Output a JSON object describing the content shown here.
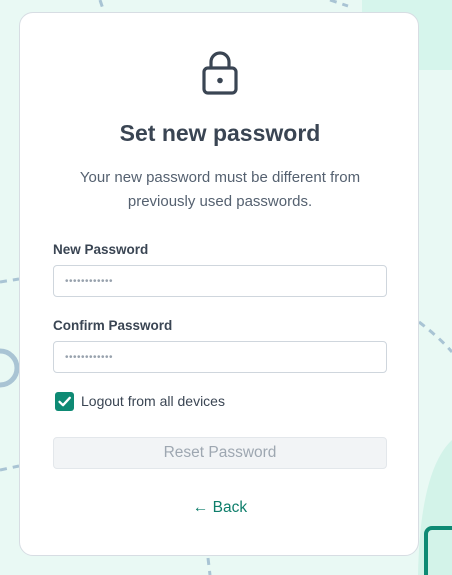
{
  "card": {
    "title": "Set new password",
    "subtitle": "Your new password must be different from previously used passwords."
  },
  "form": {
    "new_password": {
      "label": "New Password",
      "value": "••••••••••••"
    },
    "confirm_password": {
      "label": "Confirm Password",
      "value": "••••••••••••"
    },
    "logout_all": {
      "label": "Logout from all devices",
      "checked": true
    },
    "submit_label": "Reset Password"
  },
  "back": {
    "label": "← Back"
  },
  "icons": {
    "header": "lock-icon",
    "checkbox": "check-icon"
  },
  "colors": {
    "accent": "#0e8a74",
    "link": "#0e7e6b",
    "background": "#e9f9f4",
    "disabled_button_bg": "#f2f4f6",
    "disabled_button_text": "#9ea7b1"
  }
}
